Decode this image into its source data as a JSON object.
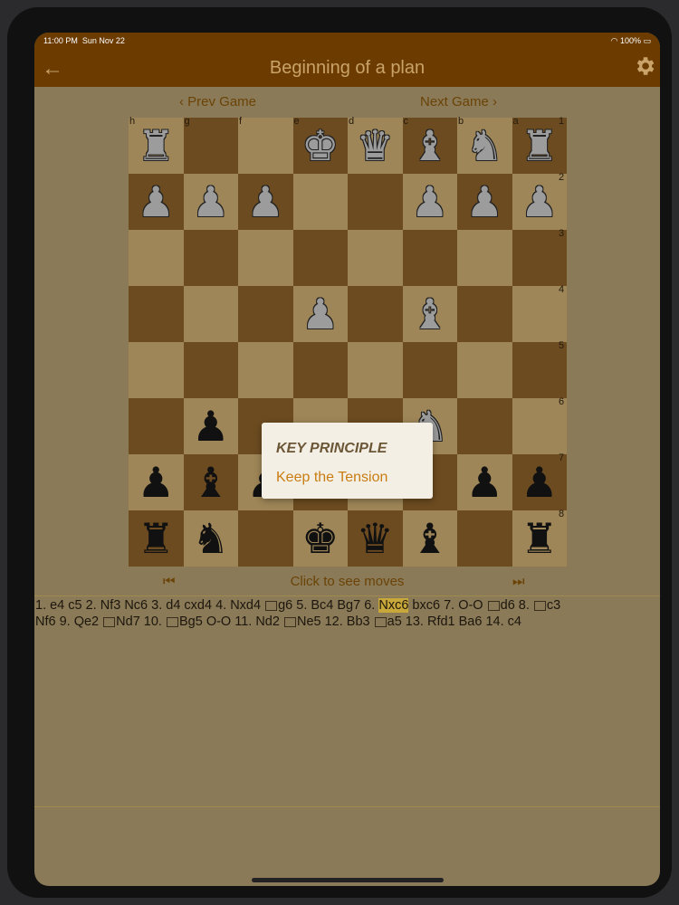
{
  "status": {
    "time": "11:00 PM",
    "date": "Sun Nov 22",
    "right": "100%"
  },
  "nav": {
    "title": "Beginning of a plan",
    "back_glyph": "←"
  },
  "game_nav": {
    "prev": "‹ Prev Game",
    "next": "Next Game ›"
  },
  "board": {
    "files": [
      "h",
      "g",
      "f",
      "e",
      "d",
      "c",
      "b",
      "a"
    ],
    "ranks": [
      "1",
      "2",
      "3",
      "4",
      "5",
      "6",
      "7",
      "8"
    ],
    "pieces": [
      {
        "color": "white",
        "glyph": "♜",
        "file": 0,
        "rank": 0
      },
      {
        "color": "white",
        "glyph": "♚",
        "file": 3,
        "rank": 0
      },
      {
        "color": "white",
        "glyph": "♛",
        "file": 4,
        "rank": 0
      },
      {
        "color": "white",
        "glyph": "♝",
        "file": 5,
        "rank": 0
      },
      {
        "color": "white",
        "glyph": "♞",
        "file": 6,
        "rank": 0
      },
      {
        "color": "white",
        "glyph": "♜",
        "file": 7,
        "rank": 0
      },
      {
        "color": "white",
        "glyph": "♟",
        "file": 0,
        "rank": 1
      },
      {
        "color": "white",
        "glyph": "♟",
        "file": 1,
        "rank": 1
      },
      {
        "color": "white",
        "glyph": "♟",
        "file": 2,
        "rank": 1
      },
      {
        "color": "white",
        "glyph": "♟",
        "file": 5,
        "rank": 1
      },
      {
        "color": "white",
        "glyph": "♟",
        "file": 6,
        "rank": 1
      },
      {
        "color": "white",
        "glyph": "♟",
        "file": 7,
        "rank": 1
      },
      {
        "color": "white",
        "glyph": "♟",
        "file": 3,
        "rank": 3
      },
      {
        "color": "white",
        "glyph": "♝",
        "file": 5,
        "rank": 3
      },
      {
        "color": "white",
        "glyph": "♞",
        "file": 5,
        "rank": 5
      },
      {
        "color": "black",
        "glyph": "♟",
        "file": 1,
        "rank": 5
      },
      {
        "color": "black",
        "glyph": "♟",
        "file": 0,
        "rank": 6
      },
      {
        "color": "black",
        "glyph": "♝",
        "file": 1,
        "rank": 6
      },
      {
        "color": "black",
        "glyph": "♟",
        "file": 2,
        "rank": 6
      },
      {
        "color": "black",
        "glyph": "♟",
        "file": 6,
        "rank": 6
      },
      {
        "color": "black",
        "glyph": "♟",
        "file": 7,
        "rank": 6
      },
      {
        "color": "black",
        "glyph": "♜",
        "file": 0,
        "rank": 7
      },
      {
        "color": "black",
        "glyph": "♞",
        "file": 1,
        "rank": 7
      },
      {
        "color": "black",
        "glyph": "♚",
        "file": 3,
        "rank": 7
      },
      {
        "color": "black",
        "glyph": "♛",
        "file": 4,
        "rank": 7
      },
      {
        "color": "black",
        "glyph": "♝",
        "file": 5,
        "rank": 7
      },
      {
        "color": "black",
        "glyph": "♜",
        "file": 7,
        "rank": 7
      }
    ]
  },
  "controls": {
    "first": "⏮",
    "moves": "Click to see moves",
    "last": "⏭"
  },
  "notation": {
    "line1": [
      "1. e4 c5 2. Nf3 Nc6 3. d4 cxd4 4. Nxd4 ",
      "g6 5. Bc4 Bg7 6. ",
      "Nxc6",
      " bxc6 7. O-O ",
      "d6 8. ",
      "c3"
    ],
    "line2": [
      "Nf6 9. Qe2 ",
      "Nd7 10. ",
      "Bg5 O-O 11. Nd2 ",
      "Ne5 12. Bb3 ",
      "a5 13. Rfd1 Ba6 14. c4"
    ]
  },
  "popup": {
    "heading": "KEY PRINCIPLE",
    "text": "Keep the Tension"
  }
}
